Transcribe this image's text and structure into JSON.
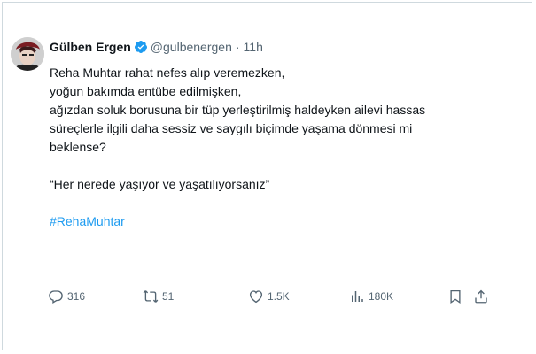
{
  "tweet": {
    "author": {
      "display_name": "Gülben Ergen",
      "handle": "@gulbenergen",
      "separator": "·",
      "time": "11h",
      "verified_icon": "verified-badge-icon"
    },
    "body_lines": [
      "Reha Muhtar rahat nefes alıp veremezken,",
      "yoğun bakımda entübe edilmişken,",
      "ağızdan soluk borusuna bir tüp yerleştirilmiş haldeyken ailevi hassas",
      "süreçlerle ilgili daha sessiz ve saygılı biçimde yaşama dönmesi mi",
      "beklense?"
    ],
    "quote": "“Her nerede yaşıyor ve yaşatılıyorsanız”",
    "hashtag": "#RehaMuhtar",
    "actions": {
      "reply_count": "316",
      "retweet_count": "51",
      "like_count": "1.5K",
      "views_count": "180K"
    },
    "colors": {
      "link": "#1d9bf0",
      "muted": "#536471",
      "verified": "#1d9bf0"
    }
  }
}
